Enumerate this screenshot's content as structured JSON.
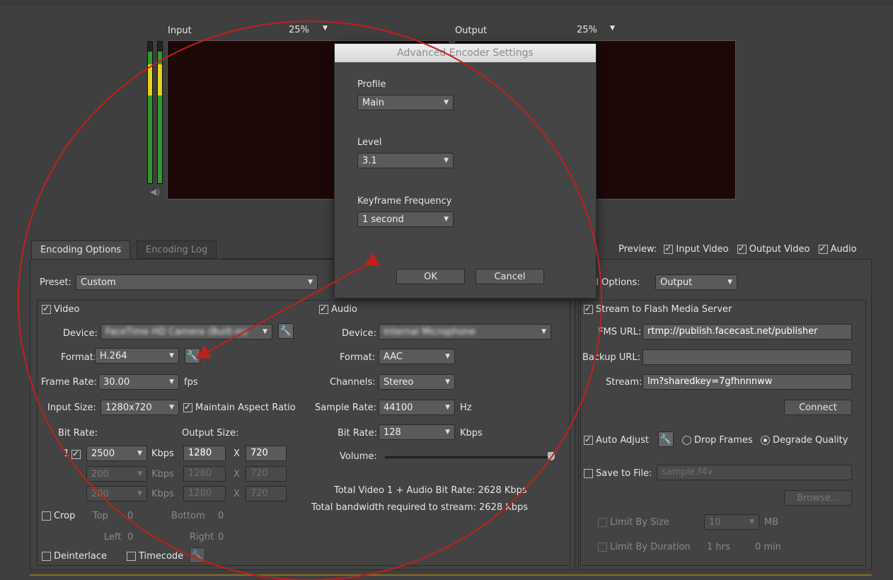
{
  "monitor": {
    "input_label": "Input",
    "input_zoom": "25%",
    "output_label": "Output",
    "output_zoom": "25%"
  },
  "tabs": {
    "encoding_options": "Encoding Options",
    "encoding_log": "Encoding Log"
  },
  "preview": {
    "label": "Preview:",
    "input_video": "Input Video",
    "output_video": "Output Video",
    "audio": "Audio"
  },
  "preset": {
    "label": "Preset:",
    "value": "Custom"
  },
  "video": {
    "label": "Video",
    "device_label": "Device:",
    "device_value": "FaceTime HD Camera (Built-in)",
    "format_label": "Format:",
    "format_value": "H.264",
    "frame_rate_label": "Frame Rate:",
    "frame_rate_value": "30.00",
    "fps": "fps",
    "input_size_label": "Input Size:",
    "input_size_value": "1280x720",
    "maintain_aspect": "Maintain Aspect Ratio",
    "bit_rate_label": "Bit Rate:",
    "output_size_label": "Output Size:",
    "row_index": "1",
    "rows": [
      {
        "bitrate": "2500",
        "unit": "Kbps",
        "w": "1280",
        "x": "X",
        "h": "720"
      },
      {
        "bitrate": "200",
        "unit": "Kbps",
        "w": "1280",
        "x": "X",
        "h": "720"
      },
      {
        "bitrate": "200",
        "unit": "Kbps",
        "w": "1280",
        "x": "X",
        "h": "720"
      }
    ],
    "crop": "Crop",
    "top": "Top",
    "top_val": "0",
    "bottom": "Bottom",
    "bottom_val": "0",
    "left": "Left",
    "left_val": "0",
    "right": "Right",
    "right_val": "0",
    "deinterlace": "Deinterlace",
    "timecode": "Timecode"
  },
  "audio": {
    "label": "Audio",
    "device_label": "Device:",
    "device_value": "Internal Microphone",
    "format_label": "Format:",
    "format_value": "AAC",
    "channels_label": "Channels:",
    "channels_value": "Stereo",
    "sample_rate_label": "Sample Rate:",
    "sample_rate_value": "44100",
    "hz": "Hz",
    "bit_rate_label": "Bit Rate:",
    "bit_rate_value": "128",
    "kbps": "Kbps",
    "volume_label": "Volume:",
    "volume_level": 0.98
  },
  "totals": {
    "total_rate": "Total Video 1 + Audio Bit Rate: 2628 Kbps",
    "bandwidth": "Total bandwidth required to stream: 2628 Kbps"
  },
  "stream": {
    "panel_options_label": "Panel Options:",
    "panel_options_visible": "nel Options:",
    "panel_options_value": "Output",
    "stream_to_fms": "Stream to Flash Media Server",
    "fms_url_label": "FMS URL:",
    "fms_url_value": "rtmp://publish.facecast.net/publisher",
    "backup_url_label": "Backup URL:",
    "backup_url_value": "",
    "stream_label": "Stream:",
    "stream_value": "lm?sharedkey=7gfhnnnww",
    "connect": "Connect",
    "auto_adjust": "Auto Adjust",
    "drop_frames": "Drop Frames",
    "degrade_quality": "Degrade Quality",
    "save_to_file": "Save to File:",
    "save_file_value": "sample.f4v",
    "browse": "Browse...",
    "limit_by_size": "Limit By Size",
    "limit_size_value": "10",
    "mb": "MB",
    "limit_by_duration": "Limit By Duration",
    "hrs": "1 hrs",
    "min": "0 min"
  },
  "dialog": {
    "title": "Advanced Encoder Settings",
    "profile_label": "Profile",
    "profile_value": "Main",
    "level_label": "Level",
    "level_value": "3.1",
    "keyframe_label": "Keyframe Frequency",
    "keyframe_value": "1 second",
    "ok": "OK",
    "cancel": "Cancel"
  },
  "colors": {
    "annotation_red": "#c0201a",
    "preview_bg": "#1d0808",
    "vu_green": "#2f9a2a",
    "vu_yellow": "#e8d21a"
  }
}
